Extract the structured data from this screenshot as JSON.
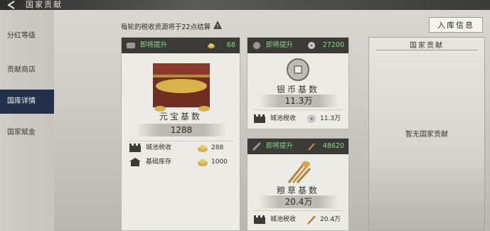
{
  "window": {
    "title": "国家贡献"
  },
  "sidebar": {
    "items": [
      {
        "label": "分红等级"
      },
      {
        "label": "贡献商店"
      },
      {
        "label": "国库详情"
      },
      {
        "label": "国家赋金"
      }
    ]
  },
  "notice": {
    "text": "每轮的税收资源将于22点结算"
  },
  "info_button": {
    "label": "入库信息"
  },
  "gold_card": {
    "tag": "即将提升",
    "count": "68",
    "title": "元宝基数",
    "value": "1288",
    "rows": [
      {
        "label": "城池税收",
        "value": "288"
      },
      {
        "label": "基础库存",
        "value": "1000"
      }
    ]
  },
  "silver_card": {
    "tag": "即将提升",
    "count": "27200",
    "title": "银币基数",
    "value": "11.3万",
    "rows": [
      {
        "label": "城池税收",
        "value": "11.3万"
      }
    ]
  },
  "grain_card": {
    "tag": "即将提升",
    "count": "48620",
    "title": "粮草基数",
    "value": "20.4万",
    "rows": [
      {
        "label": "城池税收",
        "value": "20.4万"
      }
    ]
  },
  "contribution_panel": {
    "title": "国家贡献",
    "empty_text": "暂无国家贡献"
  },
  "colors": {
    "active_tab": "#23324a",
    "tag_green": "#8fd98a",
    "header_dark": "#3a3a36"
  }
}
